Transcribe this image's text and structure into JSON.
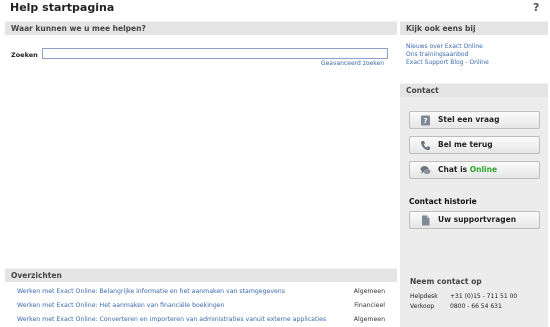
{
  "page": {
    "title": "Help startpagina",
    "help_icon": "?"
  },
  "search": {
    "section_title": "Waar kunnen we u mee helpen?",
    "label": "Zoeken",
    "value": "",
    "placeholder": "",
    "advanced_link": "Geavanceerd zoeken"
  },
  "sidebar": {
    "title": "Kijk ook eens bij",
    "links": [
      "Nieuws over Exact Online",
      "Ons trainingsaanbod",
      "Exact Support Blog - Online"
    ]
  },
  "contact": {
    "title": "Contact",
    "ask_label": "Stel een vraag",
    "call_label": "Bel me terug",
    "chat_prefix": "Chat is",
    "chat_status": "Online",
    "history_title": "Contact historie",
    "support_label": "Uw supportvragen"
  },
  "neem_contact": {
    "title": "Neem contact op",
    "rows": [
      {
        "key": "Helpdesk",
        "value": "+31 (0)15 - 711 51 00"
      },
      {
        "key": "Verkoop",
        "value": "0800 - 66 54 631"
      }
    ]
  },
  "overzichten": {
    "title": "Overzichten",
    "rows": [
      {
        "text": "Werken met Exact Online: Belangrijke informatie en het aanmaken van stamgegevens",
        "category": "Algemeen"
      },
      {
        "text": "Werken met Exact Online: Het aanmaken van financiële boekingen",
        "category": "Financieel"
      },
      {
        "text": "Werken met Exact Online: Converteren en importeren van administraties vanuit externe applicaties",
        "category": "Algemeen"
      }
    ]
  },
  "colors": {
    "link": "#3a6aad",
    "online": "#2aa52a",
    "header_bg": "#e4e4e4"
  }
}
